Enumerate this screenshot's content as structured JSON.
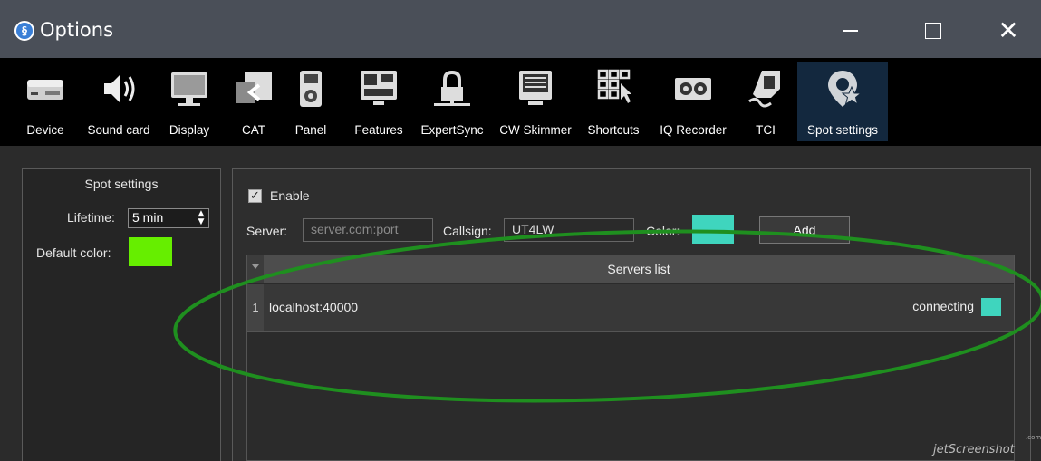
{
  "window": {
    "title": "Options",
    "minimize": "—",
    "close": "✕"
  },
  "toolbar": {
    "items": [
      {
        "label": "Device",
        "icon": "device-icon"
      },
      {
        "label": "Sound card",
        "icon": "speaker-icon"
      },
      {
        "label": "Display",
        "icon": "monitor-icon"
      },
      {
        "label": "CAT",
        "icon": "cat-icon"
      },
      {
        "label": "Panel",
        "icon": "panel-icon"
      },
      {
        "label": "Features",
        "icon": "features-icon"
      },
      {
        "label": "ExpertSync",
        "icon": "lock-icon"
      },
      {
        "label": "CW Skimmer",
        "icon": "keyboard-icon"
      },
      {
        "label": "Shortcuts",
        "icon": "shortcuts-icon"
      },
      {
        "label": "IQ Recorder",
        "icon": "recorder-icon"
      },
      {
        "label": "TCI",
        "icon": "tci-icon"
      },
      {
        "label": "Spot settings",
        "icon": "spot-settings-icon",
        "active": true
      }
    ]
  },
  "left_panel": {
    "title": "Spot settings",
    "lifetime_label": "Lifetime:",
    "lifetime_value": "5 min",
    "default_color_label": "Default color:",
    "default_color": "#66ee00"
  },
  "right_panel": {
    "enable_label": "Enable",
    "enable_checked": true,
    "server_label": "Server:",
    "server_placeholder": "server.com:port",
    "callsign_label": "Callsign:",
    "callsign_value": "UT4LW",
    "color_label": "Color:",
    "color": "#3fd5be",
    "add_label": "Add"
  },
  "servers_list": {
    "header": "Servers list",
    "rows": [
      {
        "index": "1",
        "host": "localhost:40000",
        "status": "connecting",
        "color": "#3fd5be"
      }
    ]
  },
  "watermark": {
    "text": "jetScreenshot",
    "com": ".com"
  }
}
